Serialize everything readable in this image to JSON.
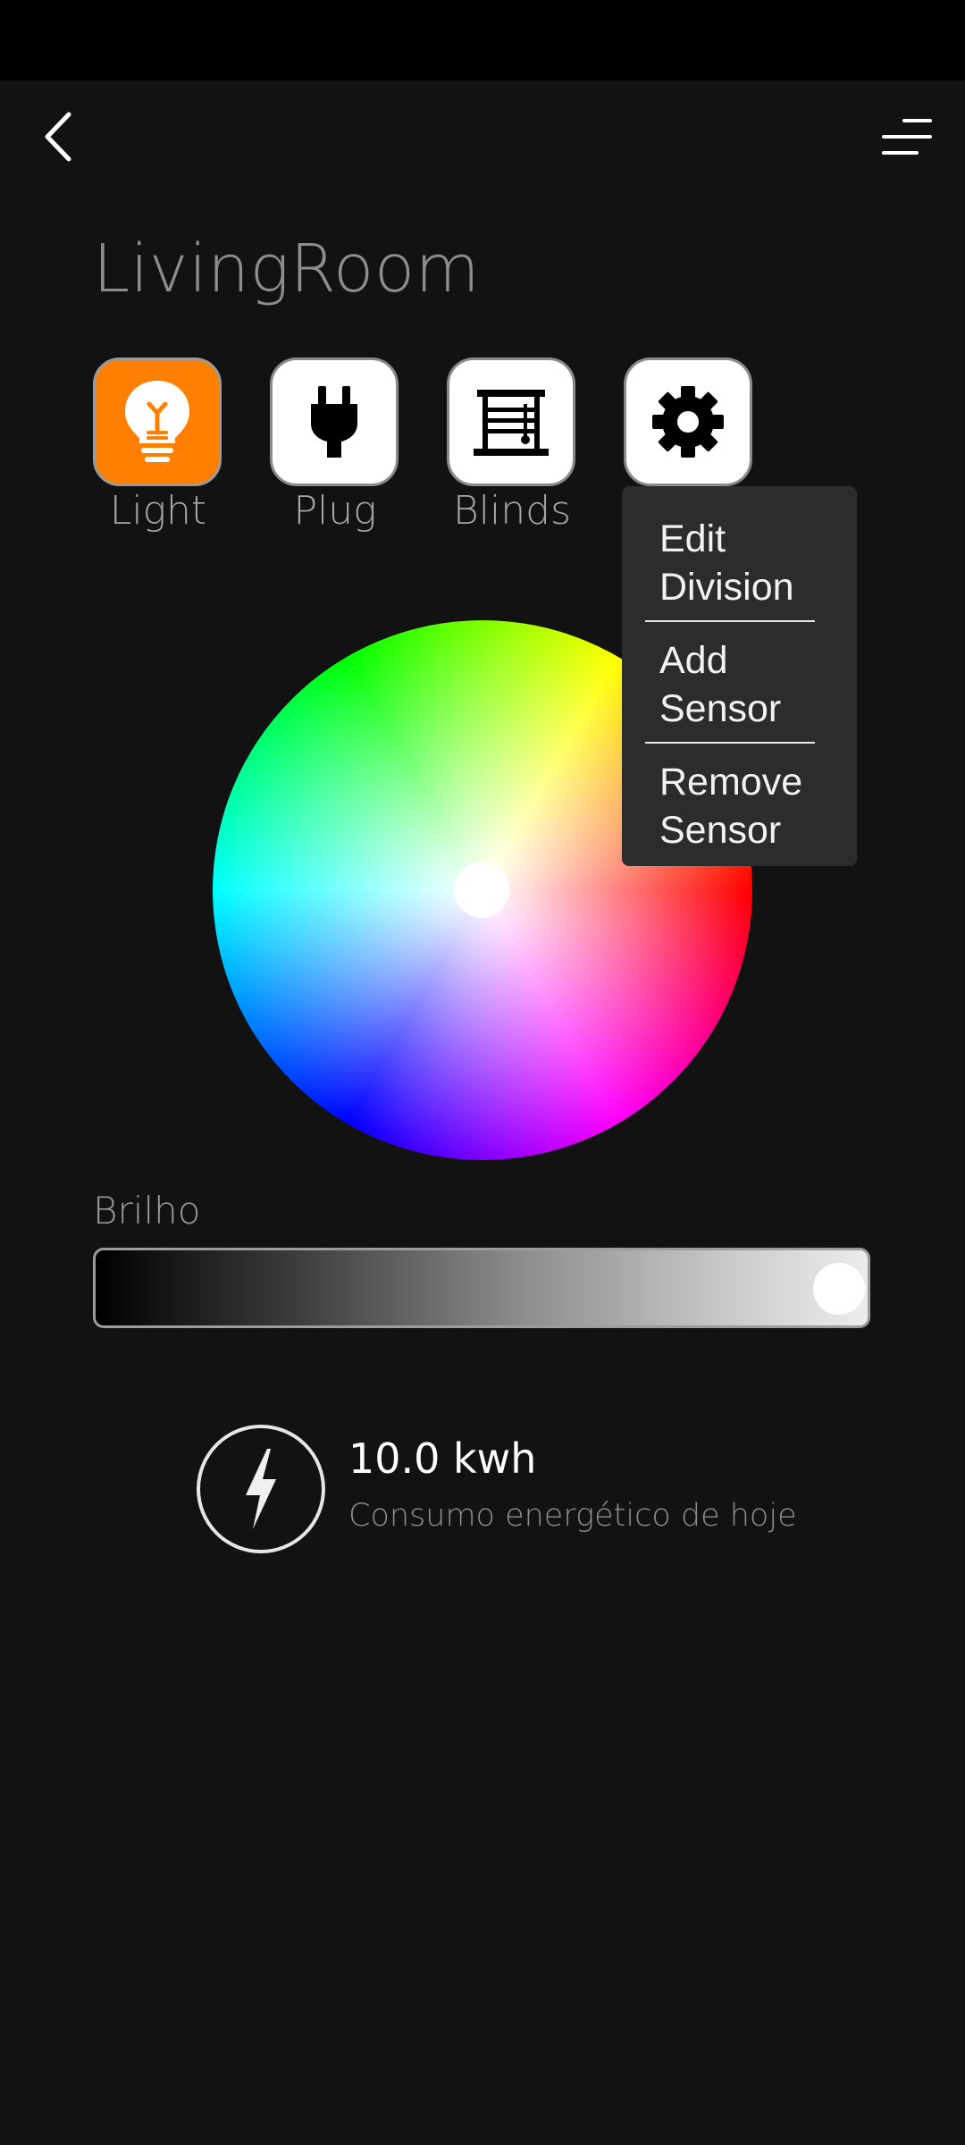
{
  "header": {
    "back_icon": "chevron-left-icon",
    "menu_icon": "filter-lines-icon"
  },
  "page": {
    "title": "LivingRoom"
  },
  "devices": [
    {
      "label": "Light",
      "icon": "lightbulb-icon",
      "active": true
    },
    {
      "label": "Plug",
      "icon": "plug-icon",
      "active": false
    },
    {
      "label": "Blinds",
      "icon": "blinds-icon",
      "active": false
    },
    {
      "label": "",
      "icon": "gear-icon",
      "active": false
    }
  ],
  "dropdown": {
    "items": [
      "Edit Division",
      "Add Sensor",
      "Remove Sensor"
    ]
  },
  "brightness": {
    "label": "Brilho",
    "level": 1.0
  },
  "energy": {
    "value": "10.0 kwh",
    "caption": "Consumo energético de hoje",
    "icon": "lightning-bolt-icon"
  },
  "colors": {
    "background": "#121212",
    "accent": "#ff8000",
    "tile": "#ffffff",
    "dropdown": "#2c2c2c"
  }
}
